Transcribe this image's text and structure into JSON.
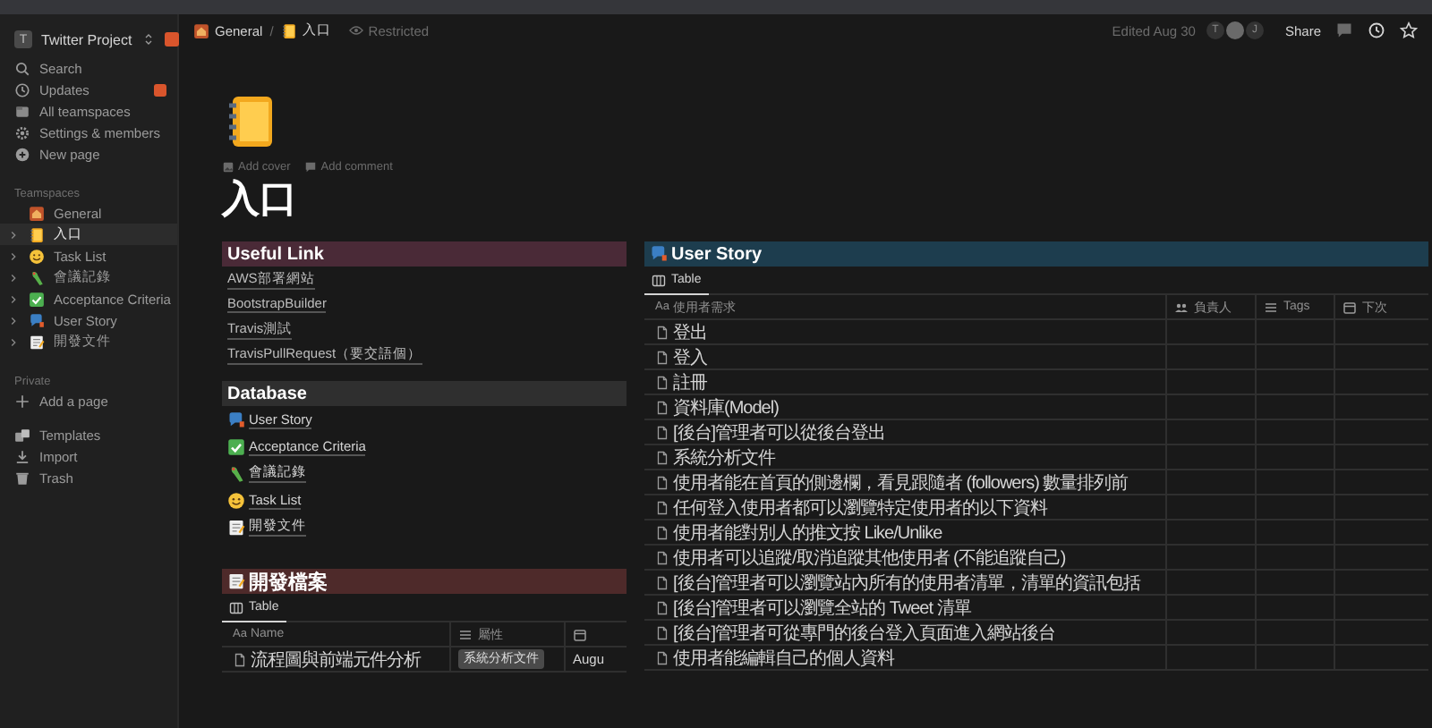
{
  "sidebar": {
    "workspace": {
      "initial": "T",
      "name": "Twitter Project"
    },
    "nav": [
      {
        "kind": "search",
        "label": "Search",
        "badge": false
      },
      {
        "kind": "clock",
        "label": "Updates",
        "badge": true
      },
      {
        "kind": "teamspaces",
        "label": "All teamspaces",
        "badge": false
      },
      {
        "kind": "gear",
        "label": "Settings & members",
        "badge": false
      },
      {
        "kind": "plus-circle",
        "label": "New page",
        "badge": false
      }
    ],
    "teamspaces_label": "Teamspaces",
    "teamspaces": [
      {
        "kind": "house",
        "label": "General",
        "selected": false,
        "expandable": false
      },
      {
        "kind": "notebook",
        "label": "入口",
        "selected": true,
        "expandable": true
      },
      {
        "kind": "smiley",
        "label": "Task List",
        "selected": false,
        "expandable": true
      },
      {
        "kind": "parrot",
        "label": "會議記錄",
        "selected": false,
        "expandable": true
      },
      {
        "kind": "check",
        "label": "Acceptance Criteria",
        "selected": false,
        "expandable": true
      },
      {
        "kind": "bubble",
        "label": "User Story",
        "selected": false,
        "expandable": true
      },
      {
        "kind": "memo",
        "label": "開發文件",
        "selected": false,
        "expandable": true
      }
    ],
    "private_label": "Private",
    "add_page": "Add a page",
    "footer": [
      {
        "kind": "templates",
        "label": "Templates"
      },
      {
        "kind": "import",
        "label": "Import"
      },
      {
        "kind": "trash",
        "label": "Trash"
      }
    ]
  },
  "topbar": {
    "breadcrumb": [
      {
        "kind": "house",
        "label": "General"
      },
      {
        "kind": "notebook",
        "label": "入口"
      }
    ],
    "separator": "/",
    "restricted": "Restricted",
    "edited": "Edited Aug 30",
    "avatars": [
      {
        "kind": "letter",
        "initial": "T"
      },
      {
        "kind": "photo"
      },
      {
        "kind": "letter",
        "initial": "J"
      }
    ],
    "share": "Share"
  },
  "page": {
    "kind": "notebook",
    "add_cover": "Add cover",
    "add_comment": "Add comment",
    "title": "入口"
  },
  "useful_link": {
    "heading": "Useful Link",
    "links": [
      "AWS部署網站",
      "BootstrapBuilder",
      "Travis測試",
      "TravisPullRequest（要交語個）"
    ]
  },
  "database": {
    "heading": "Database",
    "items": [
      {
        "kind": "bubble",
        "label": "User Story"
      },
      {
        "kind": "check",
        "label": "Acceptance Criteria"
      },
      {
        "kind": "parrot",
        "label": "會議記錄"
      },
      {
        "kind": "smiley",
        "label": "Task List"
      },
      {
        "kind": "memo",
        "label": "開發文件"
      }
    ]
  },
  "dev_files": {
    "kind": "memo",
    "heading": "開發檔案",
    "view": "Table",
    "columns": [
      {
        "kind": "title",
        "marker": "Aa",
        "label": "Name"
      },
      {
        "kind": "list",
        "label": "屬性"
      },
      {
        "kind": "date"
      }
    ],
    "rows": [
      [
        "流程圖與前端元件分析",
        "系統分析文件",
        "Augu"
      ]
    ]
  },
  "user_story": {
    "kind": "bubble",
    "heading": "User Story",
    "view": "Table",
    "columns": [
      {
        "kind": "title",
        "marker": "Aa",
        "label": "使用者需求"
      },
      {
        "kind": "person",
        "label": "負責人"
      },
      {
        "kind": "list",
        "label": "Tags"
      },
      {
        "kind": "date",
        "label": "下次"
      }
    ],
    "rows": [
      "登出",
      "登入",
      "註冊",
      "資料庫(Model)",
      "[後台]管理者可以從後台登出",
      "系統分析文件",
      "使用者能在首頁的側邊欄，看見跟隨者 (followers) 數量排列前",
      "任何登入使用者都可以瀏覽特定使用者的以下資料",
      "使用者能對別人的推文按 Like/Unlike",
      "使用者可以追蹤/取消追蹤其他使用者 (不能追蹤自己)",
      "[後台]管理者可以瀏覽站內所有的使用者清單，清單的資訊包括",
      "[後台]管理者可以瀏覽全站的 Tweet 清單",
      "[後台]管理者可從專門的後台登入頁面進入網站後台",
      "使用者能編輯自己的個人資料"
    ]
  }
}
